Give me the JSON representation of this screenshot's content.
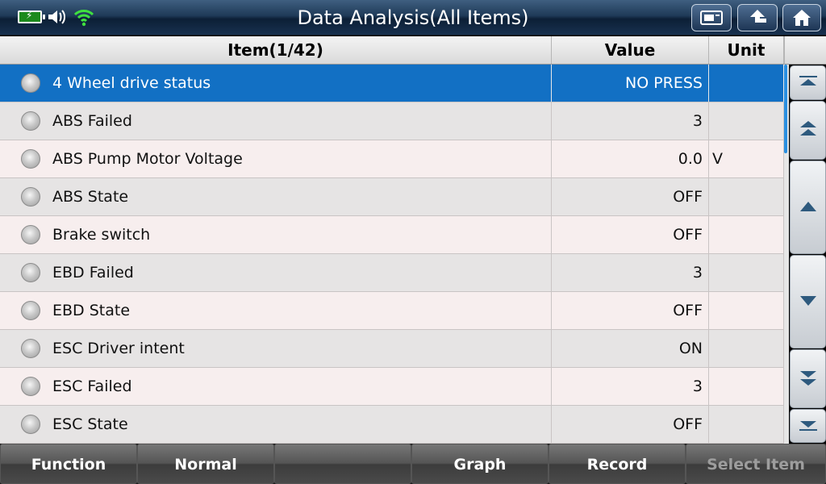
{
  "title": "Data Analysis(All Items)",
  "status_icons": [
    "battery-charging-icon",
    "speaker-icon",
    "wifi-icon"
  ],
  "toolbar_icons": [
    "screenshot-icon",
    "back-arrow-icon",
    "home-icon"
  ],
  "table": {
    "headers": {
      "item": "Item(1/42)",
      "value": "Value",
      "unit": "Unit"
    },
    "rows": [
      {
        "item": "4 Wheel drive status",
        "value": "NO PRESS",
        "unit": "",
        "selected": true
      },
      {
        "item": "ABS Failed",
        "value": "3",
        "unit": ""
      },
      {
        "item": "ABS Pump Motor Voltage",
        "value": "0.0",
        "unit": "V"
      },
      {
        "item": "ABS State",
        "value": "OFF",
        "unit": ""
      },
      {
        "item": "Brake switch",
        "value": "OFF",
        "unit": ""
      },
      {
        "item": "EBD Failed",
        "value": "3",
        "unit": ""
      },
      {
        "item": "EBD State",
        "value": "OFF",
        "unit": ""
      },
      {
        "item": "ESC Driver intent",
        "value": "ON",
        "unit": ""
      },
      {
        "item": "ESC Failed",
        "value": "3",
        "unit": ""
      },
      {
        "item": "ESC State",
        "value": "OFF",
        "unit": ""
      }
    ]
  },
  "scroll_buttons": [
    "scroll-top-icon",
    "page-up-icon",
    "line-up-icon",
    "line-down-icon",
    "page-down-icon",
    "scroll-bottom-icon"
  ],
  "bottom_buttons": [
    {
      "label": "Function",
      "enabled": true
    },
    {
      "label": "Normal",
      "enabled": true
    },
    {
      "label": "",
      "enabled": true
    },
    {
      "label": "Graph",
      "enabled": true
    },
    {
      "label": "Record",
      "enabled": true
    },
    {
      "label": "Select Item",
      "enabled": false
    }
  ],
  "colors": {
    "selected_row": "#1270c4",
    "title_bar": "#1f3a58",
    "scroll_thumb": "#2a8fe0"
  }
}
